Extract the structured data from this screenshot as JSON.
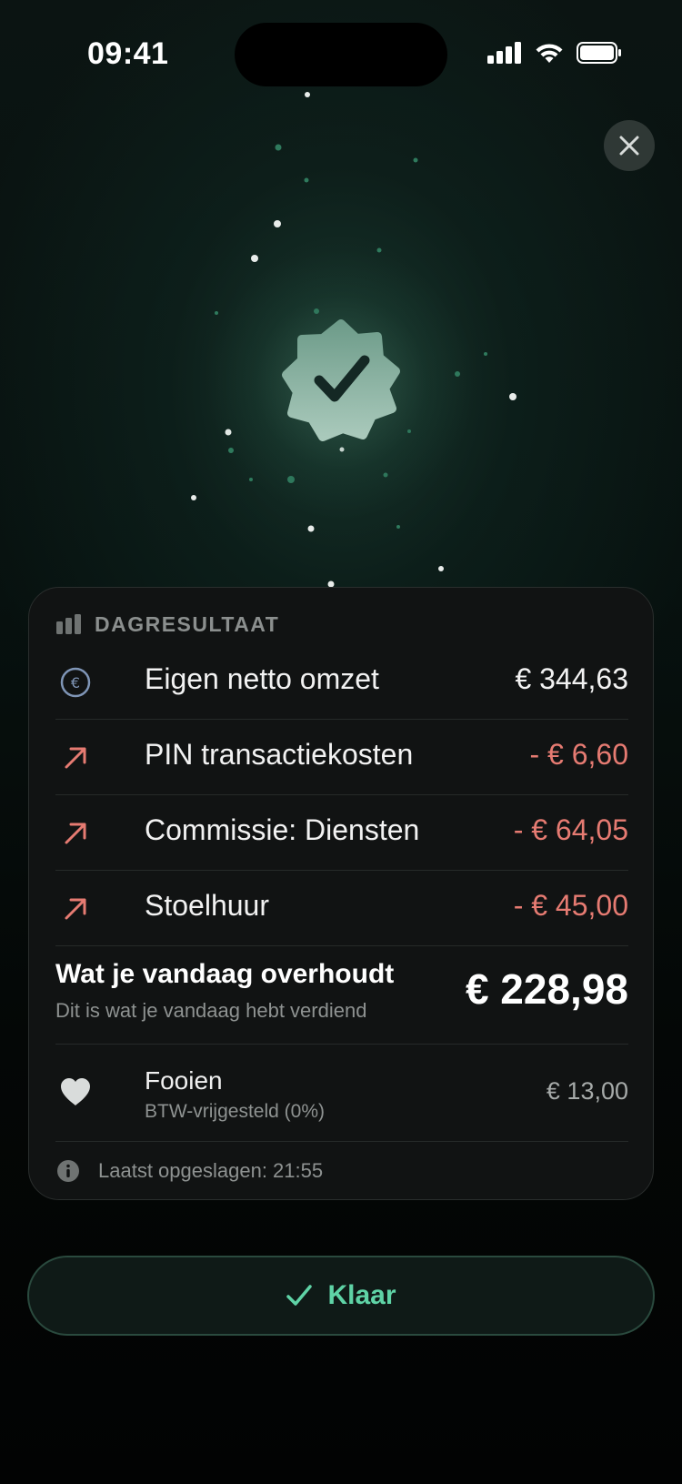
{
  "status_bar": {
    "time": "09:41"
  },
  "close_button": {
    "icon": "close-icon"
  },
  "success_badge": {
    "icon": "verified-check-badge-icon",
    "color": "#7fae9c"
  },
  "card": {
    "title": "DAGRESULTAAT",
    "header_icon": "bar-chart-icon",
    "rows": [
      {
        "icon": "euro-circle-icon",
        "label": "Eigen netto omzet",
        "value": "€ 344,63"
      },
      {
        "icon": "arrow-up-right-icon",
        "label": "PIN transactiekosten",
        "value": "- € 6,60"
      },
      {
        "icon": "arrow-up-right-icon",
        "label": "Commissie: Diensten",
        "value": "- € 64,05"
      },
      {
        "icon": "arrow-up-right-icon",
        "label": "Stoelhuur",
        "value": "- € 45,00"
      }
    ],
    "total": {
      "label": "Wat je vandaag overhoudt",
      "sublabel": "Dit is wat je vandaag hebt verdiend",
      "value": "€ 228,98"
    },
    "tips": {
      "icon": "heart-icon",
      "label": "Fooien",
      "sublabel": "BTW-vrijgesteld (0%)",
      "value": "€ 13,00"
    },
    "saved": {
      "icon": "info-icon",
      "text": "Laatst opgeslagen: 21:55"
    }
  },
  "done_button": {
    "icon": "checkmark-icon",
    "label": "Klaar"
  },
  "colors": {
    "accent": "#5fd3a6",
    "negative": "#e67b72",
    "card_background": "#111313"
  }
}
